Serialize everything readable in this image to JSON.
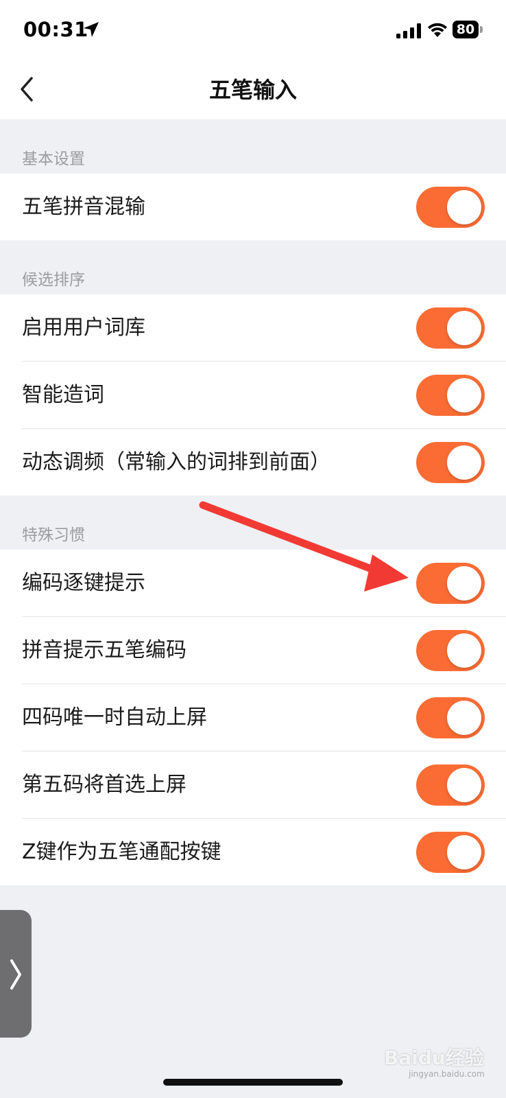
{
  "status_bar": {
    "time": "00:31",
    "battery": "80",
    "icons": [
      "location-arrow-icon",
      "cellular-signal-icon",
      "wifi-icon",
      "battery-icon"
    ]
  },
  "nav": {
    "title": "五笔输入",
    "back_icon": "chevron-left-icon"
  },
  "sections": [
    {
      "header": "基本设置",
      "rows": [
        {
          "label": "五笔拼音混输",
          "on": true
        }
      ]
    },
    {
      "header": "候选排序",
      "rows": [
        {
          "label": "启用用户词库",
          "on": true
        },
        {
          "label": "智能造词",
          "on": true
        },
        {
          "label": "动态调频（常输入的词排到前面）",
          "on": true
        }
      ]
    },
    {
      "header": "特殊习惯",
      "rows": [
        {
          "label": "编码逐键提示",
          "on": true
        },
        {
          "label": "拼音提示五笔编码",
          "on": true
        },
        {
          "label": "四码唯一时自动上屏",
          "on": true
        },
        {
          "label": "第五码将首选上屏",
          "on": true
        },
        {
          "label": "Z键作为五笔通配按键",
          "on": true
        }
      ]
    }
  ],
  "colors": {
    "toggle_on": "#fa6c34",
    "annotation_arrow": "#f23a34",
    "section_bg": "#eef0f4"
  },
  "side_handle_icon": "chevron-right-icon",
  "watermark": {
    "brand": "Baidu经验",
    "domain": "jingyan.baidu.com"
  }
}
